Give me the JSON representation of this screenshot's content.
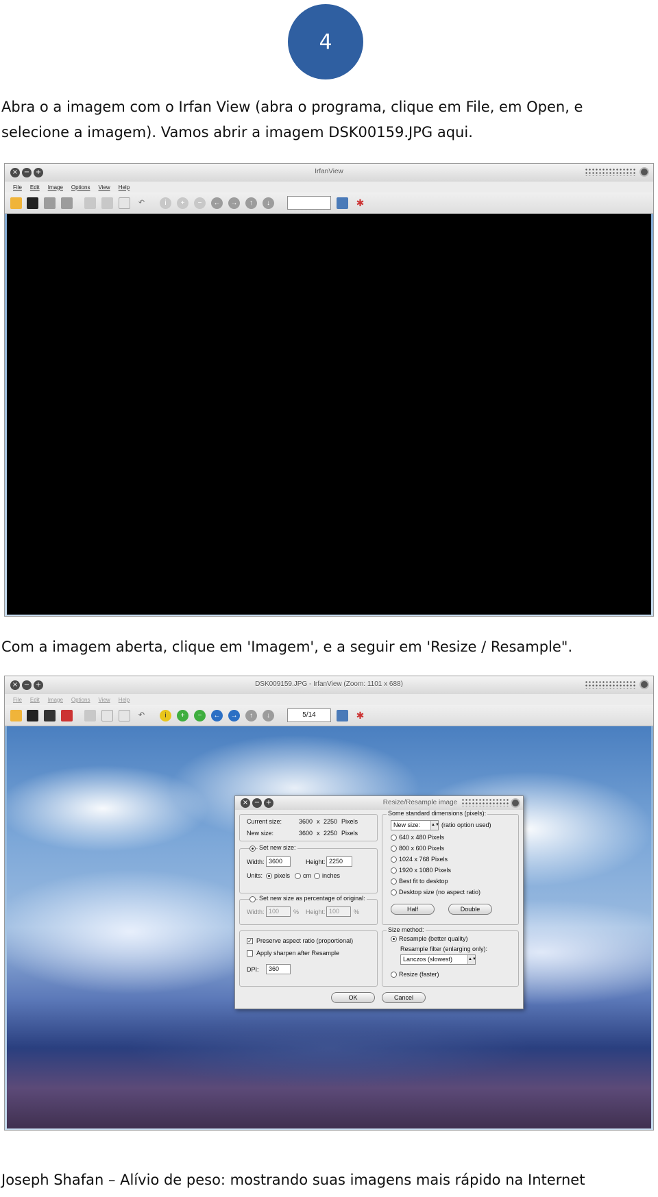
{
  "page_number": "4",
  "paragraph1": {
    "line1": "Abra o a imagem com o Irfan View (abra o programa, clique em File, em Open, e",
    "line2": "selecione a imagem). Vamos abrir a imagem DSK00159.JPG aqui."
  },
  "paragraph2": "Com a imagem aberta, clique em 'Imagem', e a seguir em 'Resize / Resample\".",
  "footer": "Joseph Shafan – Alívio de peso: mostrando suas imagens mais rápido na Internet",
  "screenshot1": {
    "window_title": "IrfanView",
    "menu": [
      "File",
      "Edit",
      "Image",
      "Options",
      "View",
      "Help"
    ],
    "page_field": ""
  },
  "screenshot2": {
    "window_title": "DSK009159.JPG - IrfanView (Zoom: 1101 x 688)",
    "menu": [
      "File",
      "Edit",
      "Image",
      "Options",
      "View",
      "Help"
    ],
    "page_field": "5/14",
    "dialog": {
      "title": "Resize/Resample image",
      "current_size_label": "Current size:",
      "current_size_w": "3600",
      "current_size_x": "x",
      "current_size_h": "2250",
      "current_size_unit": "Pixels",
      "new_size_label": "New size:",
      "new_size_w": "3600",
      "new_size_x": "x",
      "new_size_h": "2250",
      "new_size_unit": "Pixels",
      "set_new_size_label": "Set new size:",
      "width_label": "Width:",
      "width_value": "3600",
      "height_label": "Height:",
      "height_value": "2250",
      "units_label": "Units:",
      "unit_pixels": "pixels",
      "unit_cm": "cm",
      "unit_inches": "inches",
      "percent_label": "Set new size as percentage of original:",
      "pct_width_label": "Width:",
      "pct_width_value": "100",
      "pct_sign": "%",
      "pct_height_label": "Height:",
      "pct_height_value": "100",
      "preserve_label": "Preserve aspect ratio (proportional)",
      "sharpen_label": "Apply sharpen after Resample",
      "dpi_label": "DPI:",
      "dpi_value": "360",
      "std_dims_label": "Some standard dimensions (pixels):",
      "std_select_value": "New size:",
      "std_select_note": "(ratio option used)",
      "std_options": [
        "640 x 480 Pixels",
        "800 x 600 Pixels",
        "1024 x 768 Pixels",
        "1920 x 1080 Pixels",
        "Best fit to desktop",
        "Desktop size (no aspect ratio)"
      ],
      "half_label": "Half",
      "double_label": "Double",
      "size_method_label": "Size method:",
      "resample_label": "Resample (better quality)",
      "filter_label": "Resample filter (enlarging only):",
      "filter_value": "Lanczos (slowest)",
      "resize_label": "Resize (faster)",
      "ok_label": "OK",
      "cancel_label": "Cancel"
    }
  }
}
